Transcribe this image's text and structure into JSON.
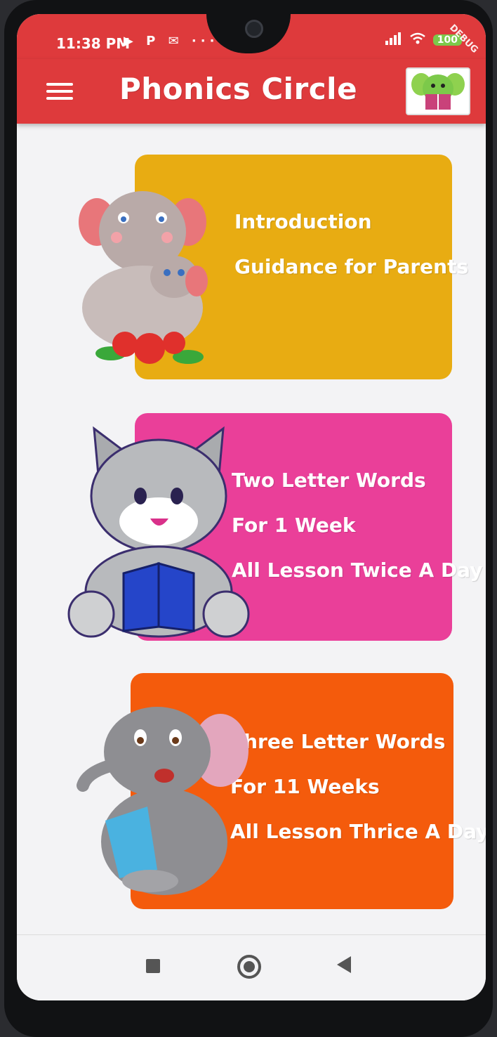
{
  "status_bar": {
    "time": "11:38 PM",
    "notification_icons": "▶ P ✉ ···",
    "battery": "100",
    "debug_label": "DEBUG"
  },
  "app_bar": {
    "title": "Phonics Circle",
    "menu_icon": "hamburger-menu-icon",
    "logo_icon": "elephant-reading-logo"
  },
  "cards": [
    {
      "color": "#e8ac12",
      "illustration": "elephant-mother-and-baby-with-roses",
      "lines": [
        "Introduction",
        "Guidance for Parents"
      ]
    },
    {
      "color": "#ea3f99",
      "illustration": "cat-reading-book",
      "lines": [
        "Two Letter Words",
        "For 1 Week",
        "All Lesson Twice A Day"
      ]
    },
    {
      "color": "#f45b0c",
      "illustration": "elephant-reading-book",
      "lines": [
        "Three Letter Words",
        "For 11 Weeks",
        "All Lesson Thrice A Day"
      ]
    }
  ],
  "nav_bar": {
    "recent_icon": "square-icon",
    "home_icon": "circle-icon",
    "back_icon": "triangle-back-icon"
  },
  "colors": {
    "app_bar": "#de3a3c",
    "background": "#f3f3f5"
  }
}
